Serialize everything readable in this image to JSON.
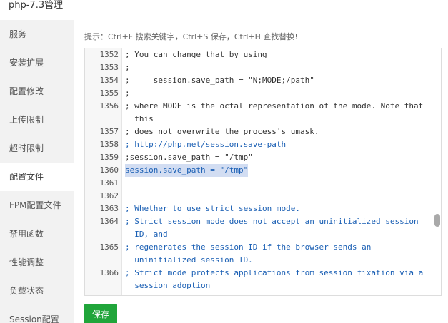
{
  "window": {
    "title": "php-7.3管理"
  },
  "sidebar": {
    "items": [
      {
        "label": "服务",
        "active": false
      },
      {
        "label": "安装扩展",
        "active": false
      },
      {
        "label": "配置修改",
        "active": false
      },
      {
        "label": "上传限制",
        "active": false
      },
      {
        "label": "超时限制",
        "active": false
      },
      {
        "label": "配置文件",
        "active": true
      },
      {
        "label": "FPM配置文件",
        "active": false
      },
      {
        "label": "禁用函数",
        "active": false
      },
      {
        "label": "性能调整",
        "active": false
      },
      {
        "label": "负载状态",
        "active": false
      },
      {
        "label": "Session配置",
        "active": false
      }
    ]
  },
  "editor": {
    "tip": "提示：Ctrl+F 搜索关键字，Ctrl+S 保存，Ctrl+H 查找替换!",
    "lines": [
      {
        "num": "1352",
        "text": "; You can change that by using"
      },
      {
        "num": "1353",
        "text": ";"
      },
      {
        "num": "1354",
        "text": ";     session.save_path = \"N;MODE;/path\""
      },
      {
        "num": "1355",
        "text": ";"
      },
      {
        "num": "1356",
        "text": "; where MODE is the octal representation of the mode. Note that"
      },
      {
        "num": "",
        "text": "  this"
      },
      {
        "num": "1357",
        "text": "; does not overwrite the process's umask."
      },
      {
        "num": "1358",
        "text": "; http://php.net/session.save-path"
      },
      {
        "num": "1359",
        "text": ";session.save_path = \"/tmp\""
      },
      {
        "num": "1360",
        "text": "session.save_path = \"/tmp\""
      },
      {
        "num": "1361",
        "text": ""
      },
      {
        "num": "1362",
        "text": ""
      },
      {
        "num": "1363",
        "text": "; Whether to use strict session mode."
      },
      {
        "num": "1364",
        "text": "; Strict session mode does not accept an uninitialized session"
      },
      {
        "num": "",
        "text": "  ID, and"
      },
      {
        "num": "1365",
        "text": "; regenerates the session ID if the browser sends an"
      },
      {
        "num": "",
        "text": "  uninitialized session ID."
      },
      {
        "num": "1366",
        "text": "; Strict mode protects applications from session fixation via a"
      },
      {
        "num": "",
        "text": "  session adoption"
      }
    ]
  },
  "save_button": {
    "label": "保存"
  },
  "colors": {
    "accent": "#20a53a",
    "link": "#1a5fb4",
    "active_line": "#e8eef7"
  }
}
